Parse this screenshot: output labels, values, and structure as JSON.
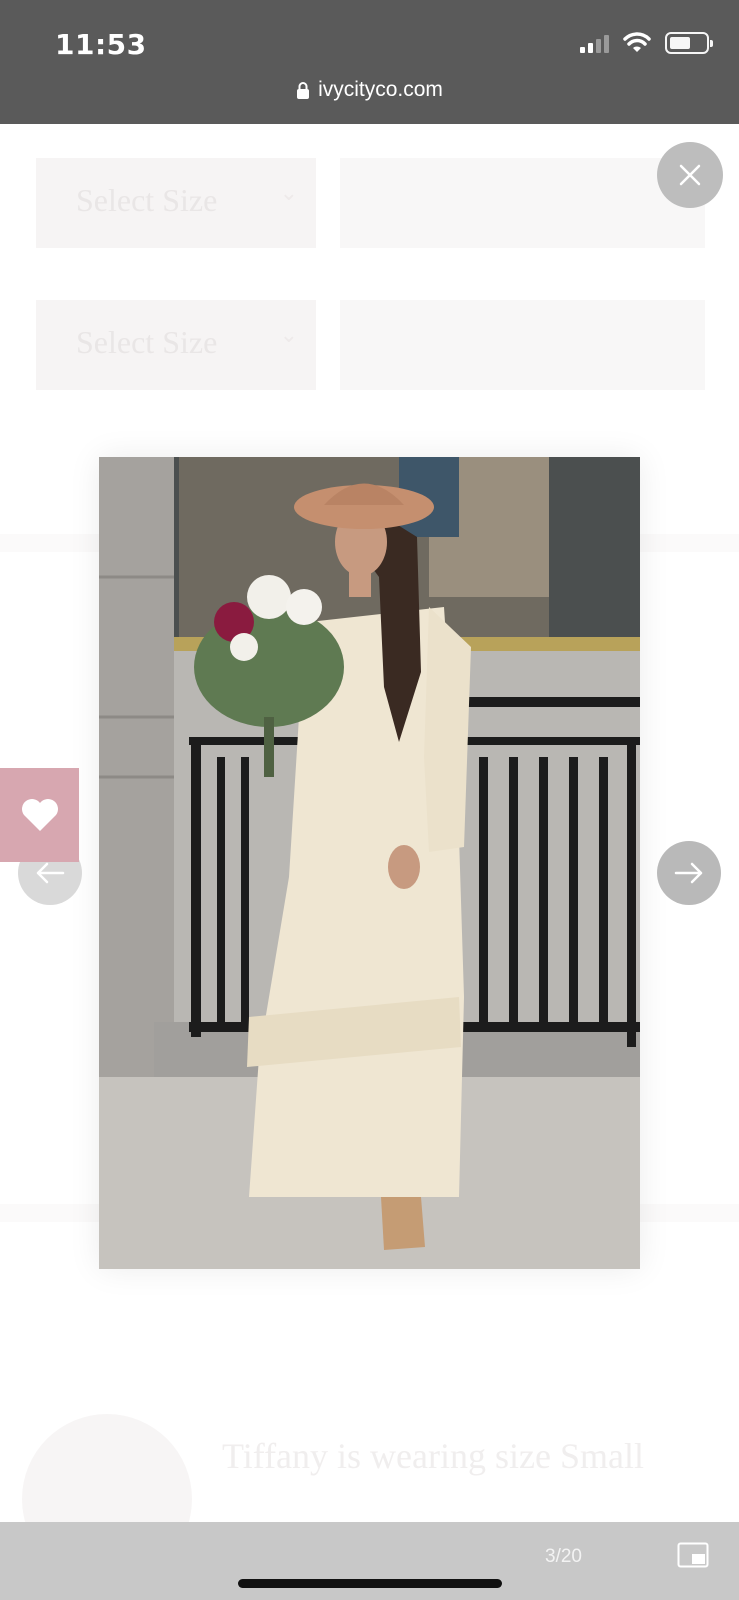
{
  "status_bar": {
    "time": "11:53"
  },
  "browser": {
    "url": "ivycityco.com"
  },
  "background_page": {
    "select_size_label_1": "Select Size",
    "select_size_label_2": "Select Size",
    "wearing_text": "Tiffany is wearing size Small"
  },
  "lightbox": {
    "counter": "3/20",
    "image_alt": "Woman in cream eyelet maxi dress and tan wide-brim hat holding a bouquet"
  },
  "icons": {
    "close": "close-icon",
    "prev": "arrow-left-icon",
    "next": "arrow-right-icon",
    "wishlist": "heart-icon",
    "pip": "picture-in-picture-icon",
    "lock": "lock-icon"
  },
  "colors": {
    "status_bar_bg": "#5a5a5a",
    "wishlist_bg": "#d7a7b0",
    "bottom_bar_bg": "#c8c8c8"
  }
}
